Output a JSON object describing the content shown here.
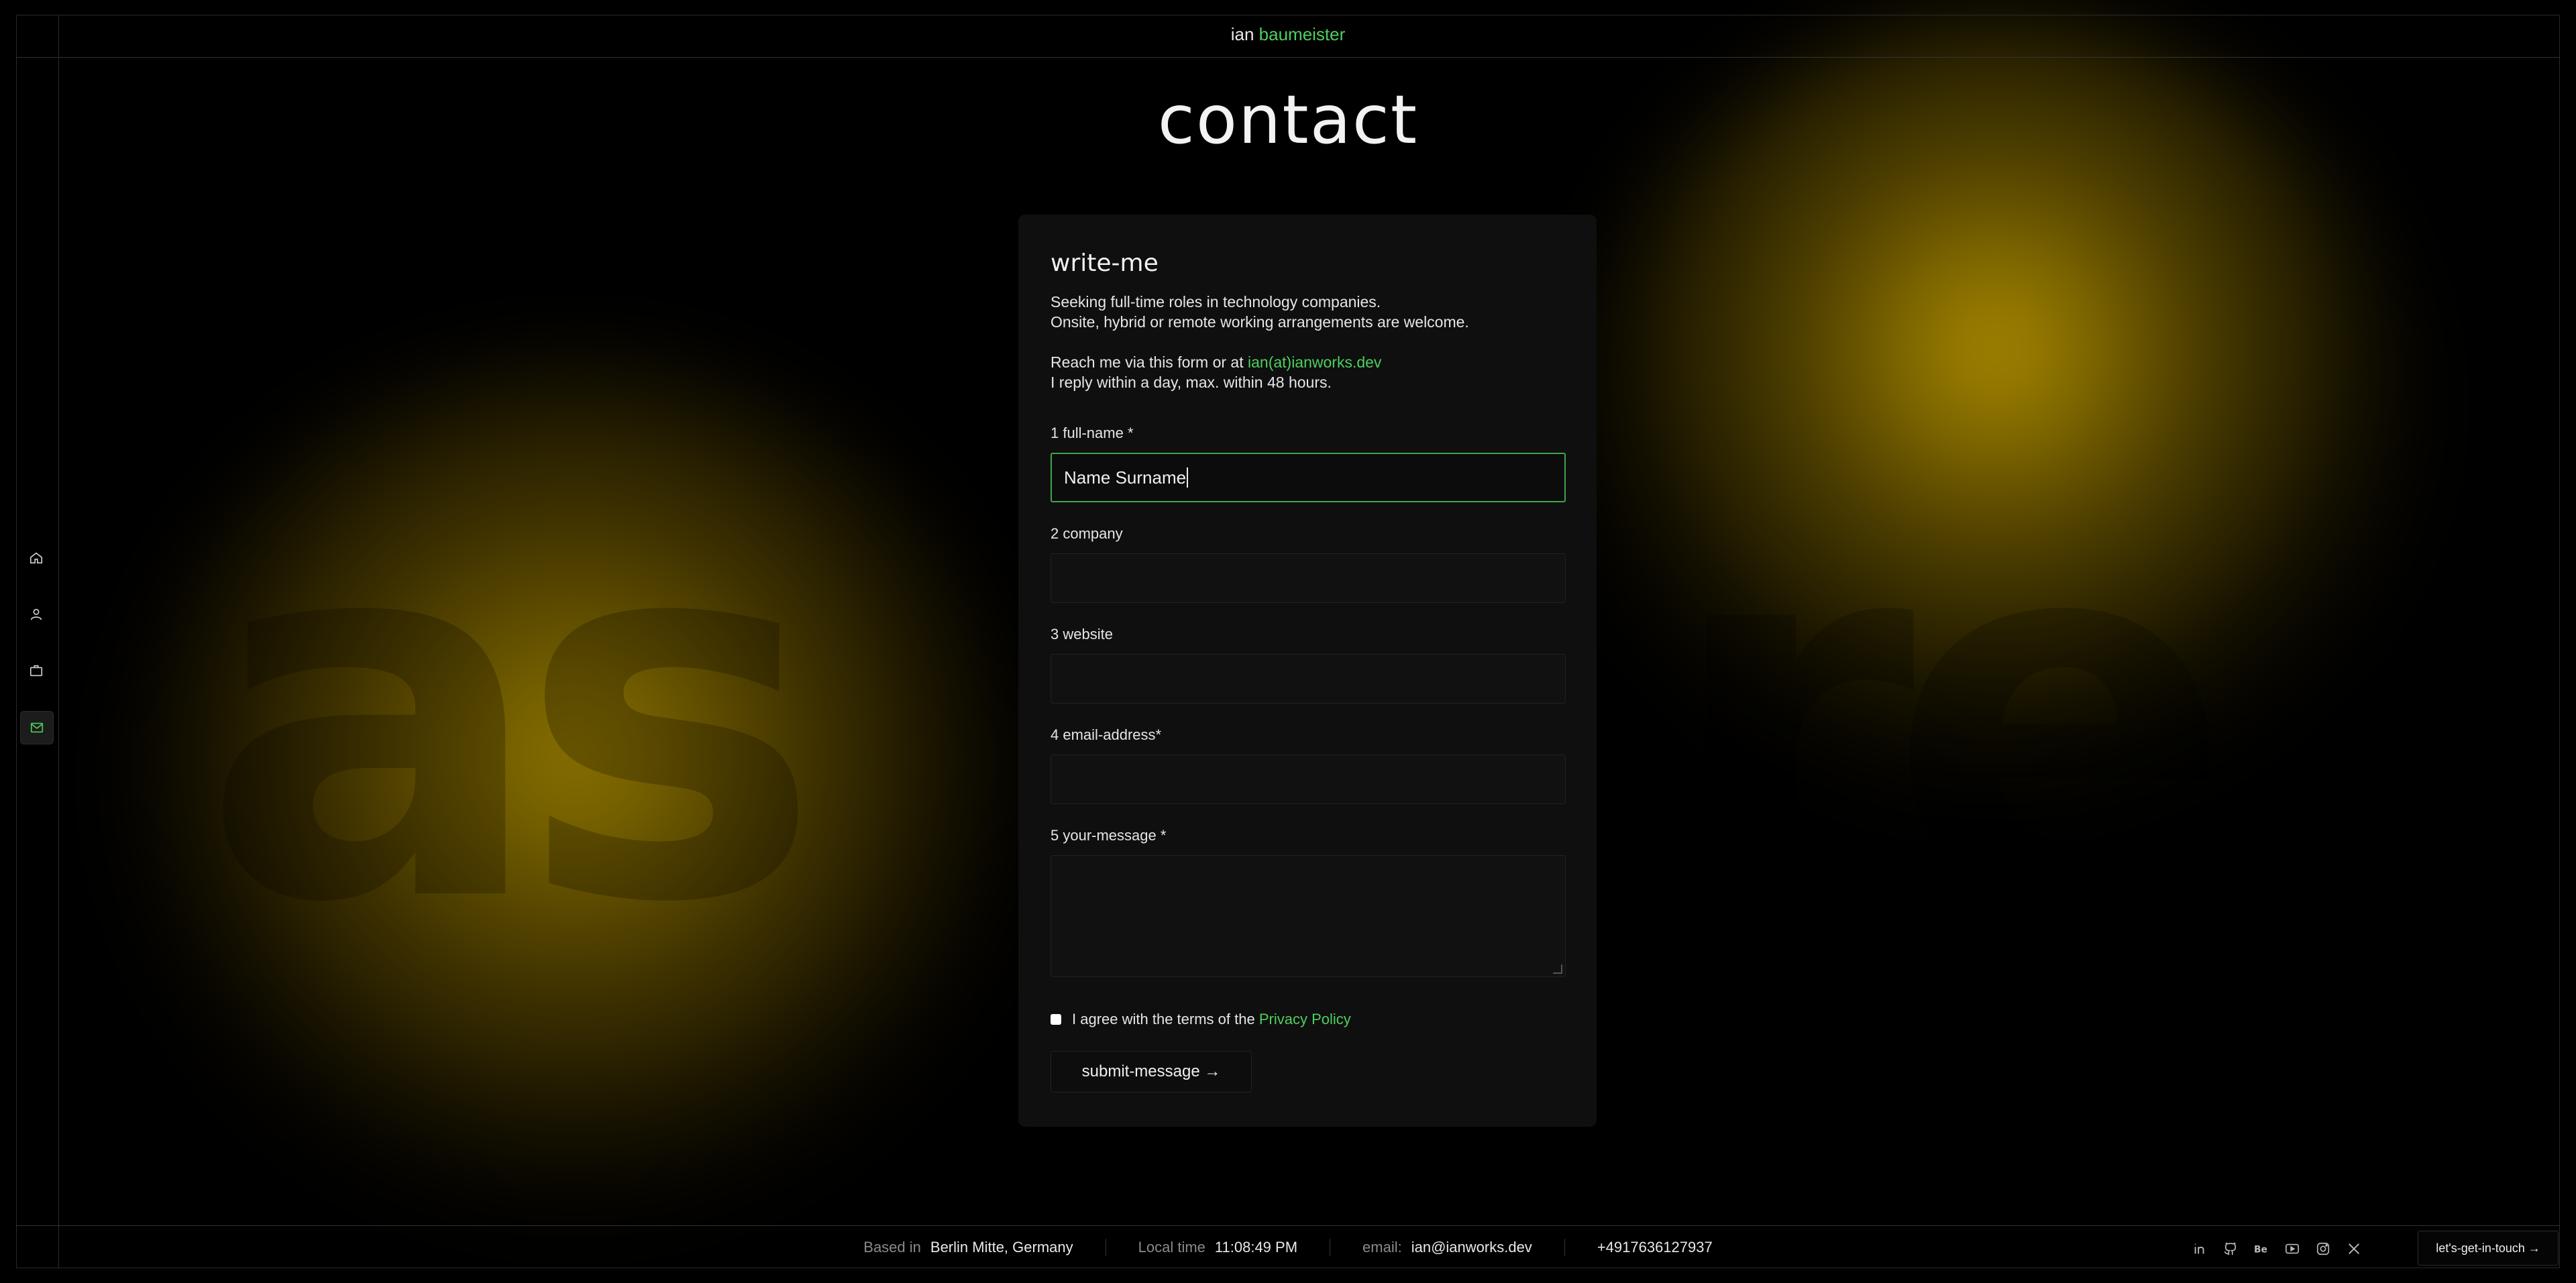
{
  "brand": {
    "first": "ian",
    "last": "baumeister"
  },
  "page": {
    "title": "contact"
  },
  "background": {
    "left_text": "as",
    "right_text": "re"
  },
  "sidebar": {
    "items": [
      {
        "icon": "home-icon",
        "active": false
      },
      {
        "icon": "user-icon",
        "active": false
      },
      {
        "icon": "briefcase-icon",
        "active": false
      },
      {
        "icon": "mail-icon",
        "active": true
      }
    ]
  },
  "form": {
    "heading": "write-me",
    "intro_line1": "Seeking full-time roles in technology companies.",
    "intro_line2": "Onsite, hybrid or remote working arrangements are welcome.",
    "reach_prefix": "Reach me via this form or at ",
    "reach_email": "ian(at)ianworks.dev",
    "reply_line": "I reply within a day, max. within 48 hours.",
    "fields": {
      "full_name": {
        "label": "1 full-name *",
        "value": "Name Surname"
      },
      "company": {
        "label": "2 company",
        "value": ""
      },
      "website": {
        "label": "3 website",
        "value": ""
      },
      "email": {
        "label": "4 email-address*",
        "value": ""
      },
      "message": {
        "label": "5 your-message *",
        "value": ""
      }
    },
    "agree_prefix": "I agree with the terms of the ",
    "agree_link": "Privacy Policy",
    "submit_label": "submit-message →"
  },
  "footer": {
    "based_label": "Based in",
    "based_value": "Berlin Mitte, Germany",
    "time_label": "Local time",
    "time_value": "11:08:49 PM",
    "email_label": "email:",
    "email_value": "ian@ianworks.dev",
    "phone": "+4917636127937",
    "social": [
      "linkedin-icon",
      "github-icon",
      "behance-icon",
      "youtube-icon",
      "instagram-icon",
      "x-icon"
    ],
    "cta_label": "let's-get-in-touch →"
  },
  "colors": {
    "accent": "#4fce5d",
    "glow": "#b89600",
    "background": "#000000"
  }
}
